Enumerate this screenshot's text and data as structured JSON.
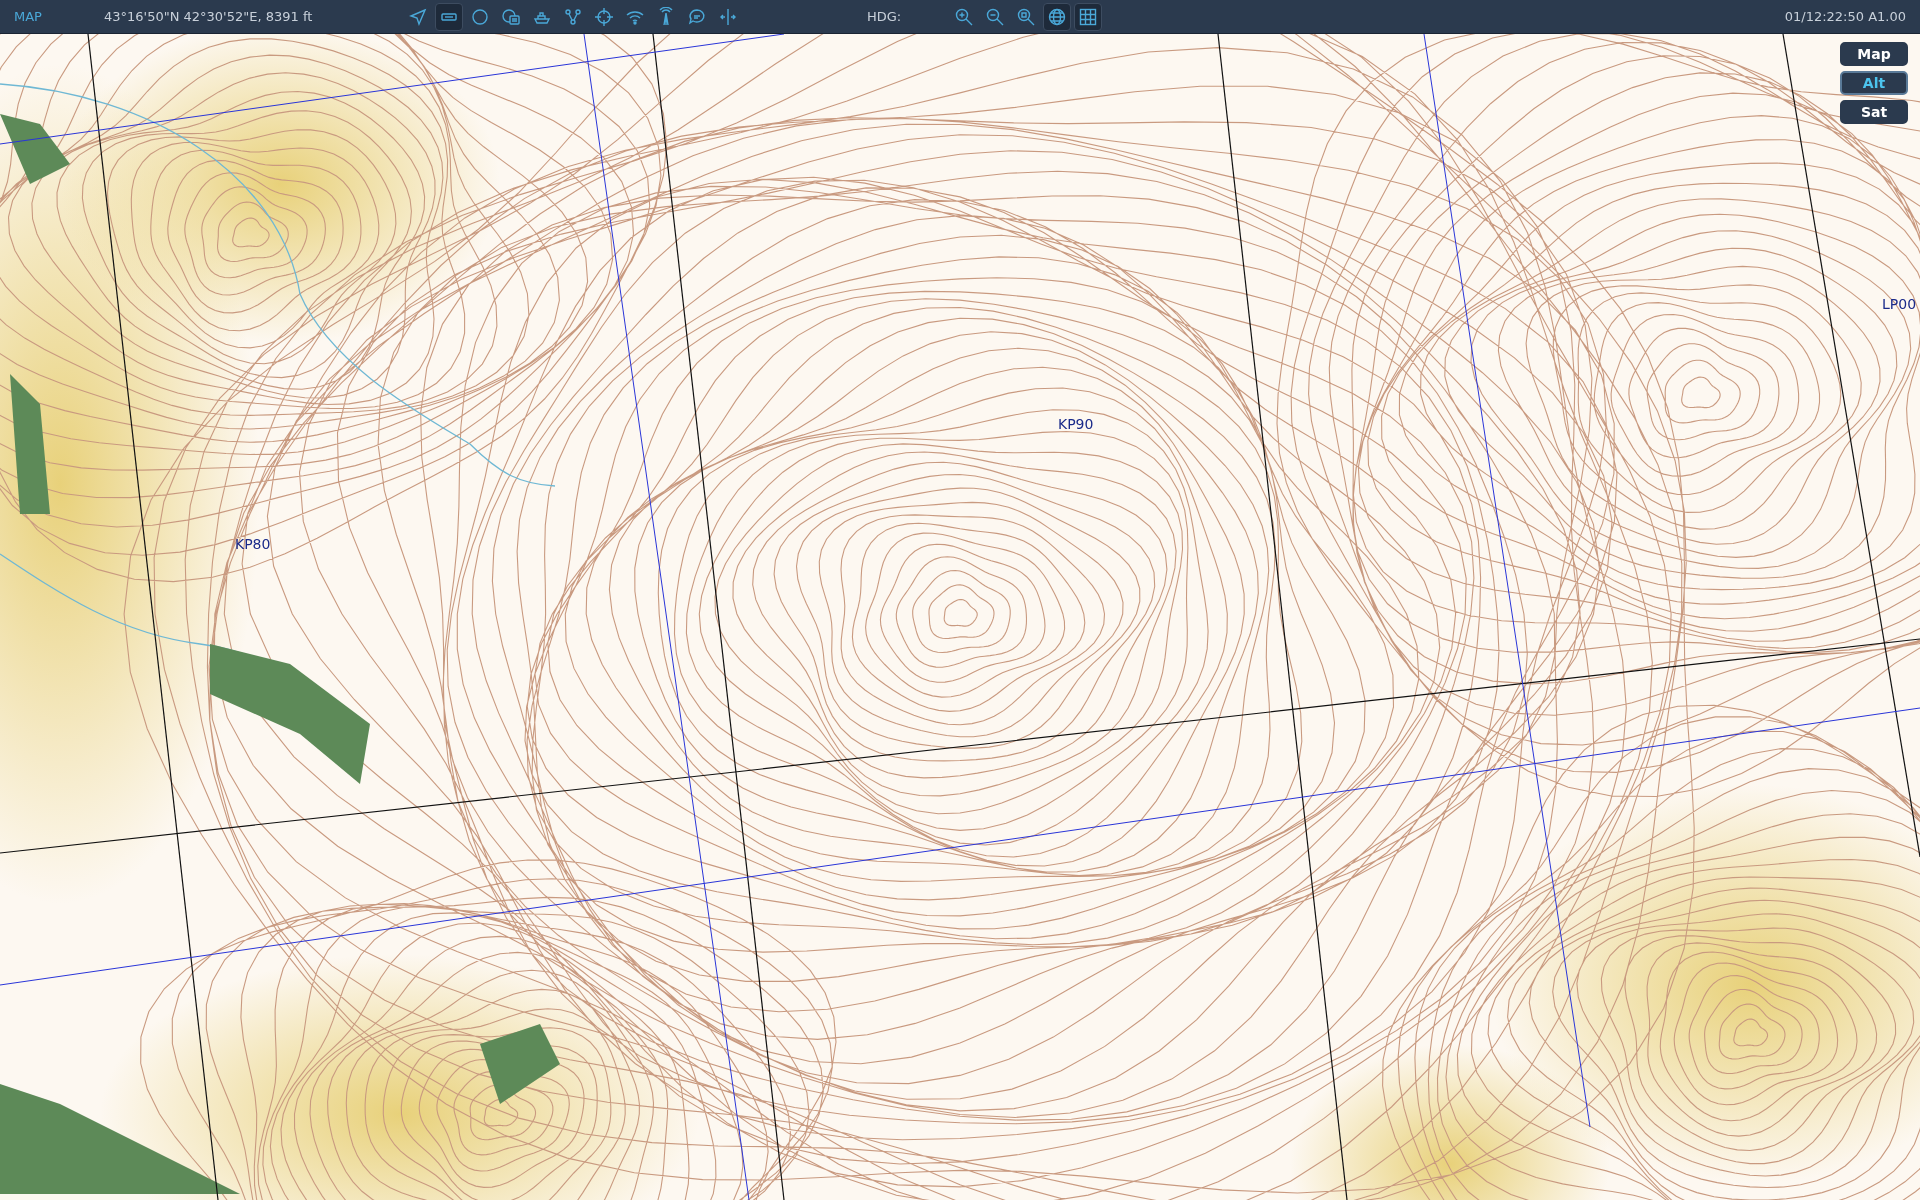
{
  "top_bar": {
    "mode": "MAP",
    "position": "43°16'50\"N 42°30'52\"E, 8391 ft",
    "tools": [
      {
        "kind": "navigate",
        "selected": false
      },
      {
        "kind": "rectangle",
        "selected": true
      },
      {
        "kind": "circle",
        "selected": false
      },
      {
        "kind": "messages",
        "selected": false
      },
      {
        "kind": "ship",
        "selected": false
      },
      {
        "kind": "network",
        "selected": false
      },
      {
        "kind": "crosshair",
        "selected": false
      },
      {
        "kind": "wifi",
        "selected": false
      },
      {
        "kind": "tower",
        "selected": false
      },
      {
        "kind": "chat",
        "selected": false
      },
      {
        "kind": "split",
        "selected": false
      }
    ],
    "heading_label": "HDG:",
    "view_tools": [
      {
        "kind": "zoom-in",
        "selected": false
      },
      {
        "kind": "zoom-out",
        "selected": false
      },
      {
        "kind": "zoom-fit",
        "selected": false
      },
      {
        "kind": "globe",
        "selected": true
      },
      {
        "kind": "grid",
        "selected": true
      }
    ],
    "clock": "01/12:22:50 A1.00"
  },
  "map": {
    "grid_labels": [
      "KP80",
      "KP90",
      "LP00"
    ],
    "layers": [
      {
        "label": "Map",
        "selected": false
      },
      {
        "label": "Alt",
        "selected": true
      },
      {
        "label": "Sat",
        "selected": false
      }
    ]
  }
}
